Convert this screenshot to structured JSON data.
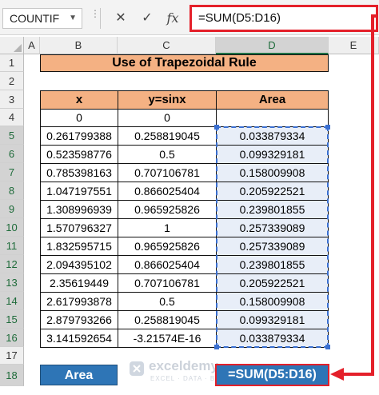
{
  "formula_bar": {
    "name_box": "COUNTIF",
    "cancel_icon": "✕",
    "enter_icon": "✓",
    "fx_icon": "fx",
    "formula": "=SUM(D5:D16)"
  },
  "columns": [
    "A",
    "B",
    "C",
    "D",
    "E"
  ],
  "rows": [
    "1",
    "2",
    "3",
    "4",
    "5",
    "6",
    "7",
    "8",
    "9",
    "10",
    "11",
    "12",
    "13",
    "14",
    "15",
    "16",
    "17",
    "18"
  ],
  "sheet": {
    "title": "Use of Trapezoidal Rule",
    "headers": [
      "x",
      "y=sinx",
      "Area"
    ],
    "data": [
      [
        "0",
        "0",
        ""
      ],
      [
        "0.261799388",
        "0.258819045",
        "0.033879334"
      ],
      [
        "0.523598776",
        "0.5",
        "0.099329181"
      ],
      [
        "0.785398163",
        "0.707106781",
        "0.158009908"
      ],
      [
        "1.047197551",
        "0.866025404",
        "0.205922521"
      ],
      [
        "1.308996939",
        "0.965925826",
        "0.239801855"
      ],
      [
        "1.570796327",
        "1",
        "0.257339089"
      ],
      [
        "1.832595715",
        "0.965925826",
        "0.257339089"
      ],
      [
        "2.094395102",
        "0.866025404",
        "0.239801855"
      ],
      [
        "2.35619449",
        "0.707106781",
        "0.205922521"
      ],
      [
        "2.617993878",
        "0.5",
        "0.158009908"
      ],
      [
        "2.879793266",
        "0.258819045",
        "0.099329181"
      ],
      [
        "3.141592654",
        "-3.21574E-16",
        "0.033879334"
      ]
    ],
    "area_label": "Area",
    "area_formula": "=SUM(D5:D16)"
  },
  "watermark": {
    "brand": "exceldemy",
    "tagline": "EXCEL · DATA · BI"
  },
  "colors": {
    "title_fill": "#f4b183",
    "area_fill": "#2e75b6",
    "highlight_red": "#e4202a",
    "selection_green": "#217346"
  }
}
